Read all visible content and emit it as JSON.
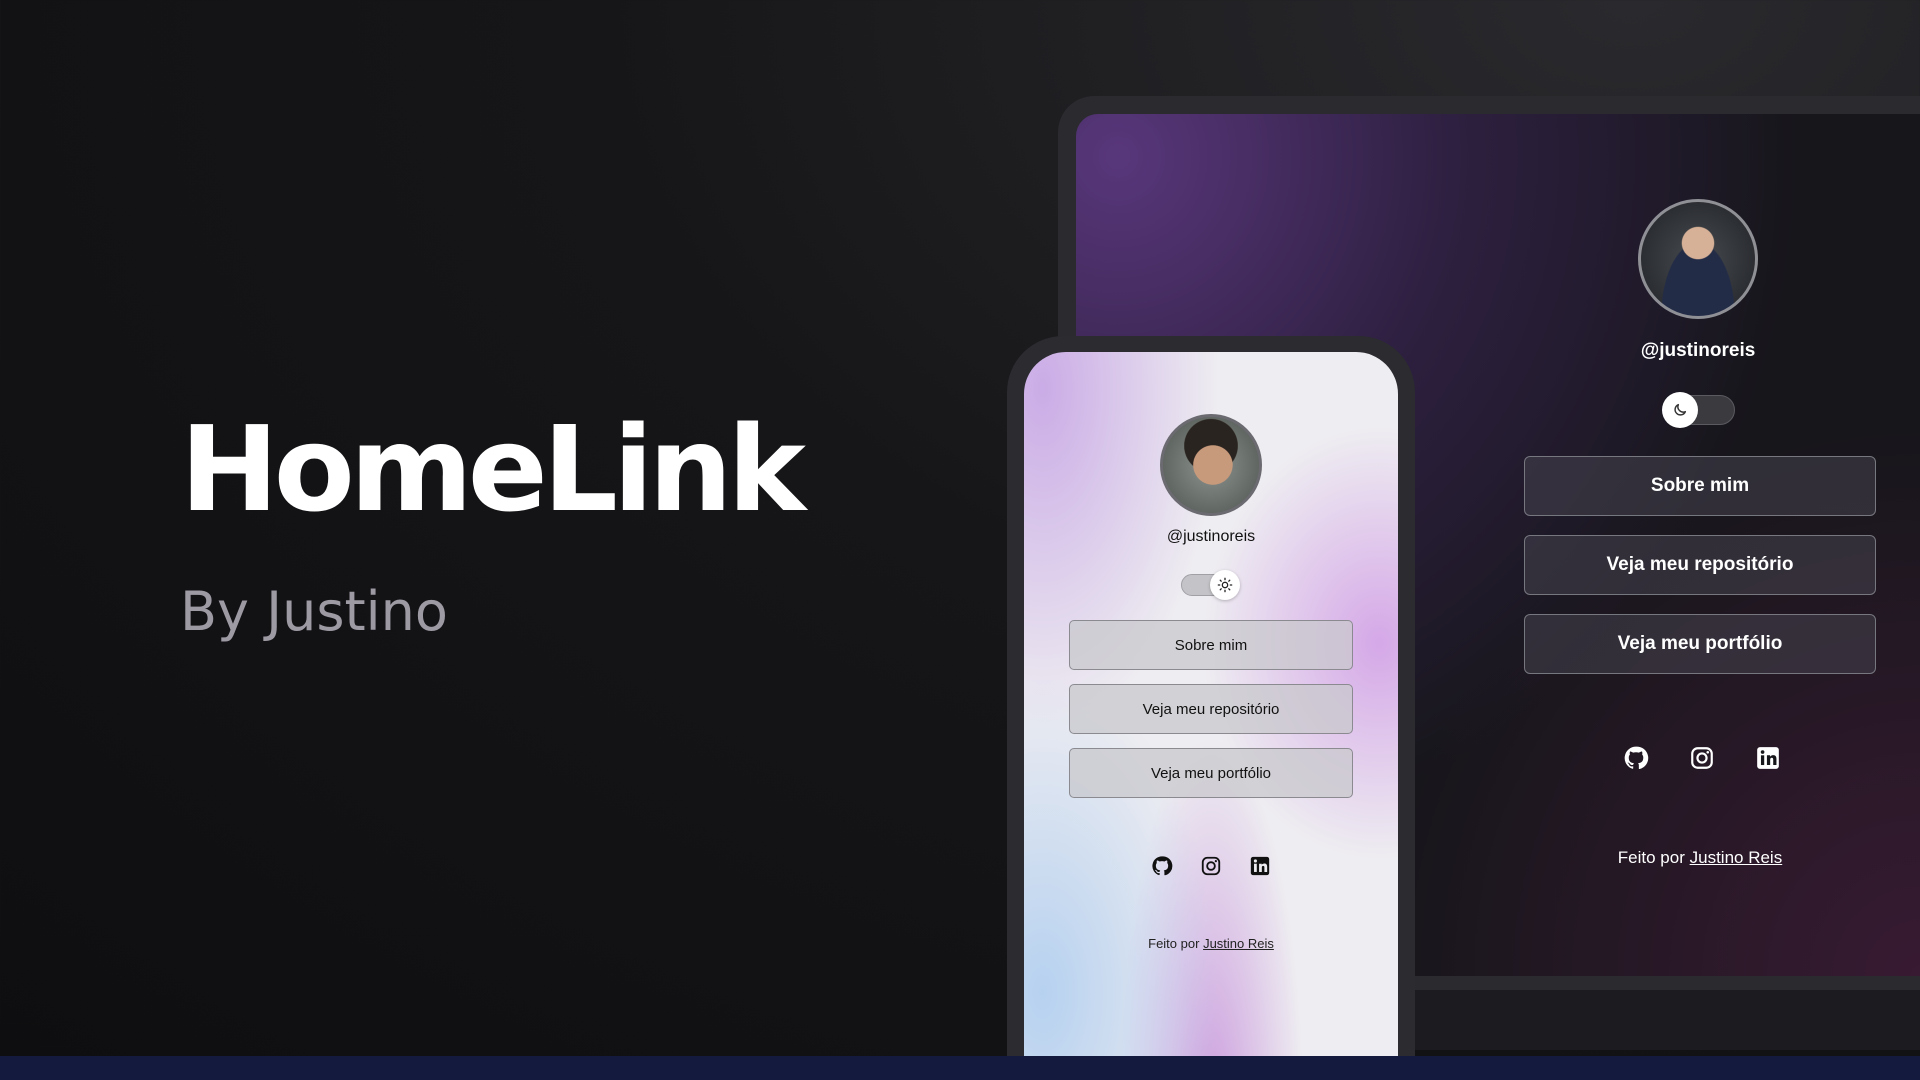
{
  "hero": {
    "title": "HomeLink",
    "subtitle": "By Justino"
  },
  "desktop": {
    "username": "@justinoreis",
    "theme": "dark",
    "buttons": [
      "Sobre mim",
      "Veja meu repositório",
      "Veja meu portfólio"
    ],
    "social": [
      "github-icon",
      "instagram-icon",
      "linkedin-icon"
    ],
    "footer_prefix": "Feito por",
    "footer_link": "Justino Reis"
  },
  "mobile": {
    "username": "@justinoreis",
    "theme": "light",
    "buttons": [
      "Sobre mim",
      "Veja meu repositório",
      "Veja meu portfólio"
    ],
    "social": [
      "github-icon",
      "instagram-icon",
      "linkedin-icon"
    ],
    "footer_prefix": "Feito por",
    "footer_link": "Justino Reis"
  },
  "colors": {
    "background": "#0e0e10",
    "bottom_bar": "#141a3e",
    "desktop_accent": "#5c3880",
    "mobile_accent": "#d2a0e6"
  }
}
